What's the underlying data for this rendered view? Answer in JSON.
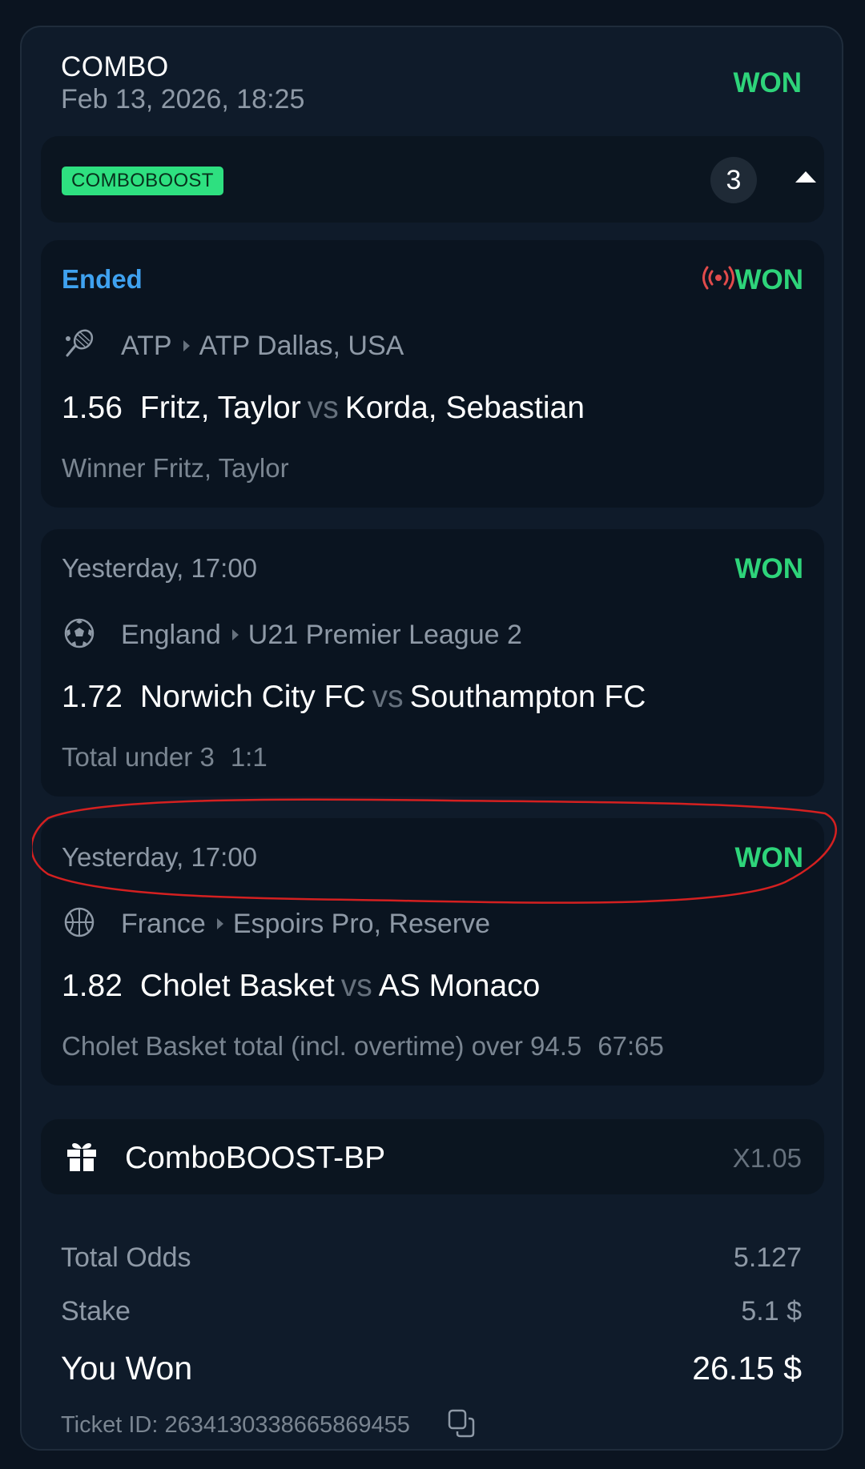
{
  "bet": {
    "type": "COMBO",
    "date": "Feb 13, 2026, 18:25",
    "status": "WON",
    "badge": "COMBOBOOST",
    "selection_count": "3"
  },
  "events": [
    {
      "status": "Ended",
      "result": "WON",
      "live": true,
      "sport_icon": "tennis-icon",
      "country": "ATP",
      "league": "ATP Dallas, USA",
      "odds": "1.56",
      "home": "Fritz, Taylor",
      "vs": "vs",
      "away": "Korda, Sebastian",
      "pick": "Winner Fritz, Taylor",
      "score": ""
    },
    {
      "status": "Yesterday, 17:00",
      "result": "WON",
      "live": false,
      "sport_icon": "soccer-ball-icon",
      "country": "England",
      "league": "U21 Premier League 2",
      "odds": "1.72",
      "home": "Norwich City FC",
      "vs": "vs",
      "away": "Southampton FC",
      "pick": "Total under 3",
      "score": "1:1"
    },
    {
      "status": "Yesterday, 17:00",
      "result": "WON",
      "live": false,
      "sport_icon": "basketball-icon",
      "country": "France",
      "league": "Espoirs Pro, Reserve",
      "odds": "1.82",
      "home": "Cholet Basket",
      "vs": "vs",
      "away": "AS Monaco",
      "pick": "Cholet Basket total (incl. overtime) over 94.5",
      "score": "67:65"
    }
  ],
  "boost": {
    "icon": "gift-icon",
    "label": "ComboBOOST-BP",
    "multiplier": "X1.05"
  },
  "summary": {
    "total_odds_label": "Total Odds",
    "total_odds": "5.127",
    "stake_label": "Stake",
    "stake": "5.1 $",
    "won_label": "You Won",
    "won": "26.15 $",
    "ticket": "Ticket ID: 263413033866586945​5"
  },
  "colors": {
    "won": "#2ed47a",
    "ended": "#3fa2f0",
    "live": "#e14b4b",
    "badge": "#2ee080",
    "annotation": "#d42020"
  }
}
